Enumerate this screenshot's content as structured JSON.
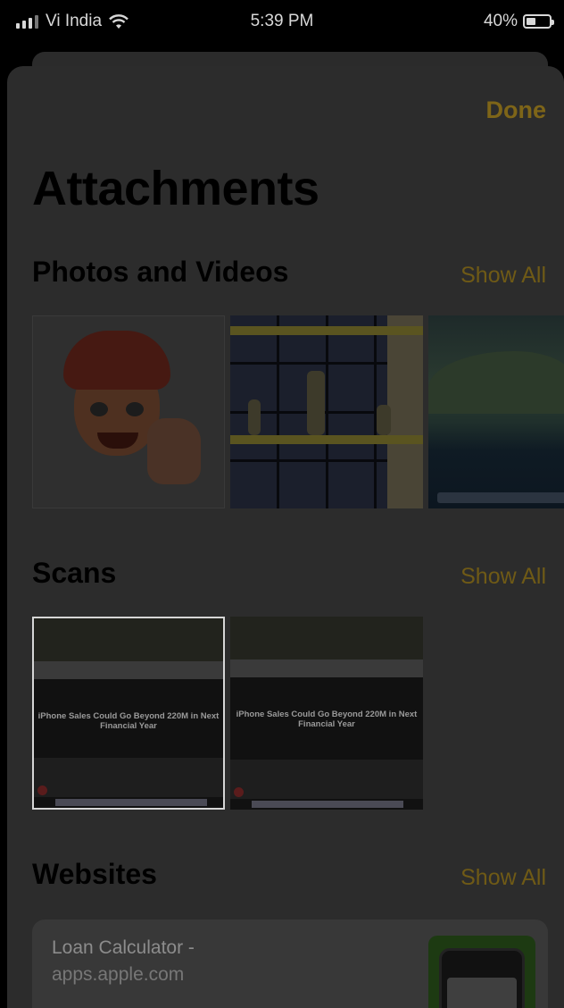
{
  "status_bar": {
    "carrier": "Vi India",
    "time": "5:39 PM",
    "battery_percent": "40%",
    "battery_level": 0.4
  },
  "header": {
    "done_label": "Done",
    "title": "Attachments"
  },
  "sections": {
    "photos": {
      "title": "Photos and Videos",
      "show_all": "Show All"
    },
    "scans": {
      "title": "Scans",
      "show_all": "Show All",
      "items": [
        {
          "headline": "iPhone Sales Could Go Beyond 220M in Next Financial Year"
        },
        {
          "headline": "iPhone Sales Could Go Beyond 220M in Next Financial Year"
        }
      ]
    },
    "websites": {
      "title": "Websites",
      "show_all": "Show All",
      "item": {
        "title": "Loan  Calculator -",
        "domain": "apps.apple.com"
      }
    }
  },
  "colors": {
    "accent_dimmed": "#7e6518",
    "background": "#000000",
    "sheet": "#2c2c2c"
  },
  "icons": [
    "signal-icon",
    "wifi-icon",
    "battery-icon"
  ]
}
